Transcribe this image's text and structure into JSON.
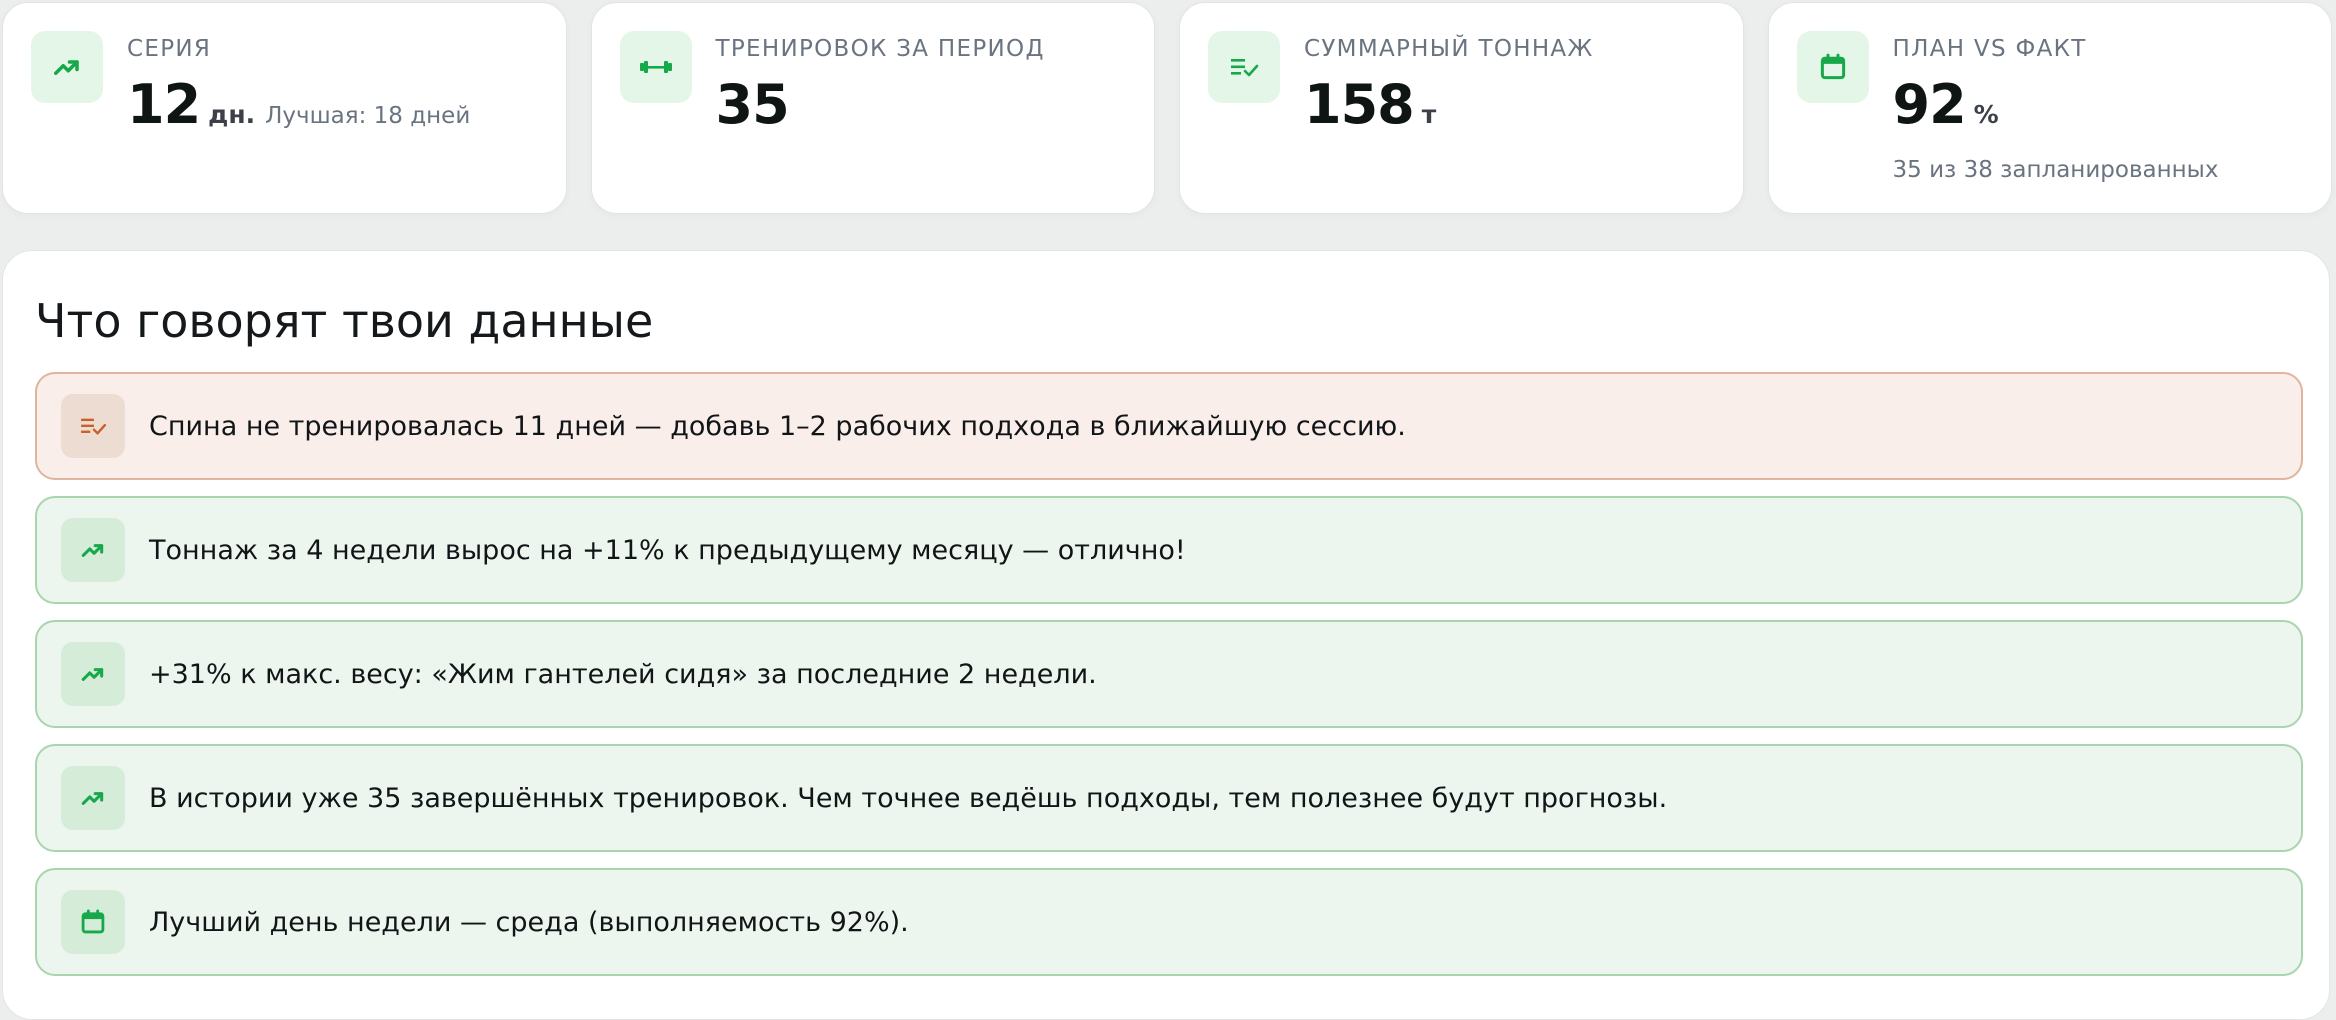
{
  "colors": {
    "accent_green": "#17a84a",
    "warn_orange": "#c8602b",
    "muted_text": "#6a7480"
  },
  "stats": [
    {
      "icon": "trending-up-icon",
      "label": "СЕРИЯ",
      "value": "12",
      "unit": "дн.",
      "extra": "Лучшая: 18 дней"
    },
    {
      "icon": "dumbbell-icon",
      "label": "ТРЕНИРОВОК ЗА ПЕРИОД",
      "value": "35"
    },
    {
      "icon": "list-check-icon",
      "label": "СУММАРНЫЙ ТОННАЖ",
      "value": "158",
      "unit": "т"
    },
    {
      "icon": "calendar-icon",
      "label": "ПЛАН VS ФАКТ",
      "value": "92",
      "unit": "%",
      "sub": "35 из 38 запланированных"
    }
  ],
  "insights": {
    "title": "Что говорят твои данные",
    "items": [
      {
        "type": "warn",
        "icon": "list-check-icon",
        "text": "Спина не тренировалась 11 дней — добавь 1–2 рабочих подхода в ближайшую сессию."
      },
      {
        "type": "good",
        "icon": "trending-up-icon",
        "text": "Тоннаж за 4 недели вырос на +11% к предыдущему месяцу — отлично!"
      },
      {
        "type": "good",
        "icon": "trending-up-icon",
        "text": "+31% к макс. весу: «Жим гантелей сидя» за последние 2 недели."
      },
      {
        "type": "good",
        "icon": "trending-up-icon",
        "text": "В истории уже 35 завершённых тренировок. Чем точнее ведёшь подходы, тем полезнее будут прогнозы."
      },
      {
        "type": "good",
        "icon": "calendar-icon",
        "text": "Лучший день недели — среда (выполняемость 92%)."
      }
    ]
  }
}
